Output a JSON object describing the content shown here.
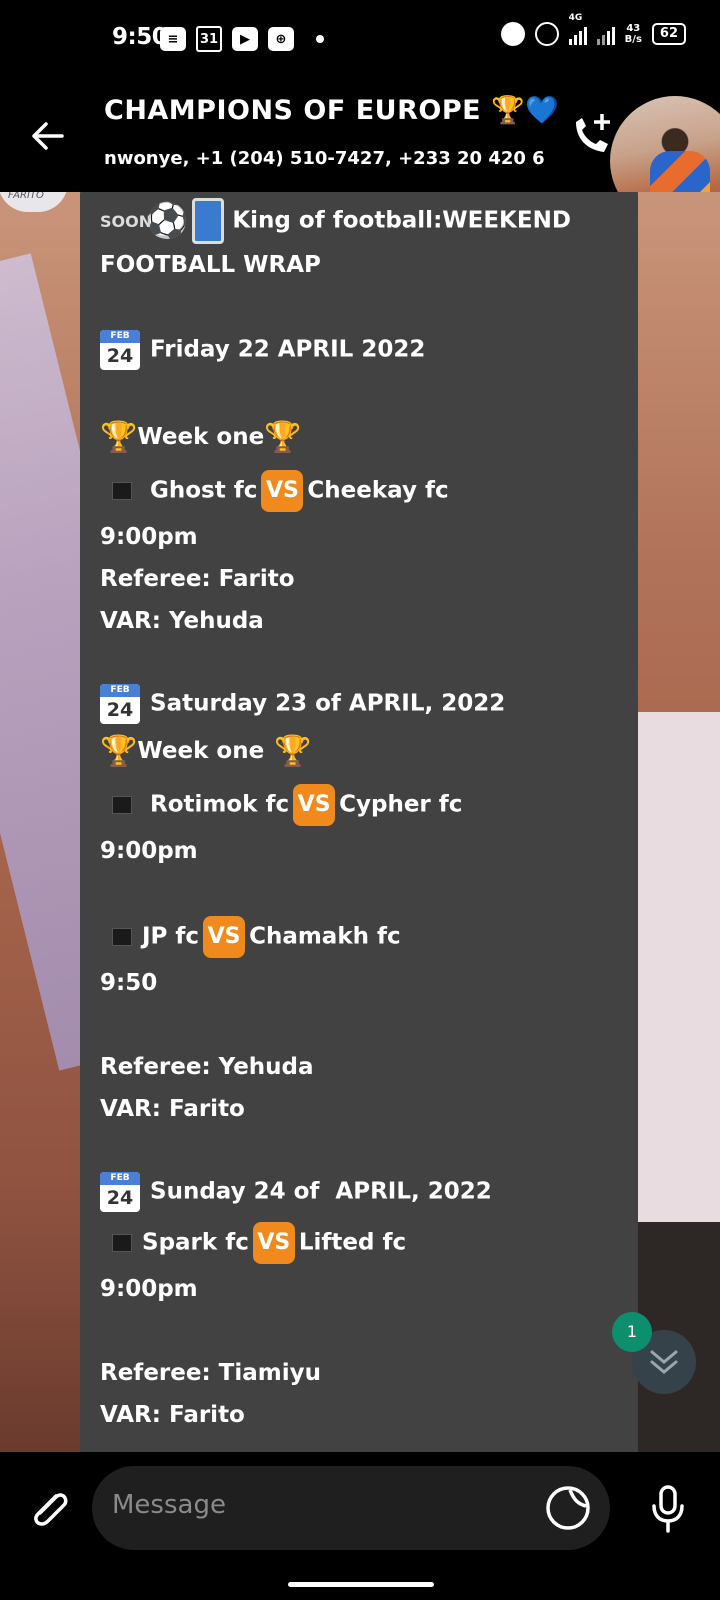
{
  "status_bar": {
    "time": "9:50",
    "calendar_day": "31",
    "network_type": "4G",
    "net_speed": "43",
    "net_speed_unit": "B/s",
    "battery": "62"
  },
  "header": {
    "title": "CHAMPIONS OF EUROPE 🏆💙",
    "members": "nwonye, +1 (204) 510-7427, +233 20 420 6..."
  },
  "message": {
    "intro_soon": "SOON",
    "intro_line1": "King of football:WEEKEND",
    "intro_line2": "FOOTBALL WRAP",
    "calendar_icon_month": "FEB",
    "calendar_icon_day": "24",
    "vs_label": "VS",
    "day1": {
      "date": "Friday 22 APRIL 2022",
      "week": "Week one",
      "home": "Ghost fc",
      "away": "Cheekay fc",
      "time": "9:00pm",
      "referee": "Referee: Farito",
      "var": "VAR: Yehuda"
    },
    "day2": {
      "date": "Saturday 23 of APRIL, 2022",
      "week": "Week one",
      "match1_home": "Rotimok fc",
      "match1_away": "Cypher fc",
      "match1_time": "9:00pm",
      "match2_home": "JP fc",
      "match2_away": "Chamakh fc",
      "match2_time": "9:50",
      "referee": "Referee: Yehuda",
      "var": "VAR: Farito"
    },
    "day3": {
      "date": "Sunday 24 of  APRIL, 2022",
      "home": "Spark fc",
      "away": "Lifted fc",
      "time": "9:00pm",
      "referee": "Referee: Tiamiyu",
      "var": "VAR: Farito"
    }
  },
  "unread_count": "1",
  "composer": {
    "placeholder": "Message"
  },
  "background_logo": "FARITO"
}
